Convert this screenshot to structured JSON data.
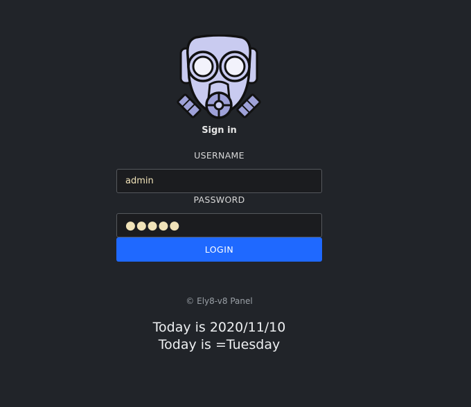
{
  "header": {
    "logo_icon": "gas-mask-icon",
    "sign_in": "Sign in"
  },
  "form": {
    "username_label": "USERNAME",
    "username_value": "admin",
    "password_label": "PASSWORD",
    "password_value": "●●●●●",
    "login_label": "LOGIN"
  },
  "footer": {
    "copyright": "© Ely8-v8 Panel",
    "date_line": "Today is 2020/11/10",
    "day_line": "Today is =Tuesday"
  },
  "colors": {
    "background": "#212429",
    "accent": "#1f69ff",
    "input_text": "#f0e2b8",
    "mask_fill": "#c9cbf0"
  }
}
